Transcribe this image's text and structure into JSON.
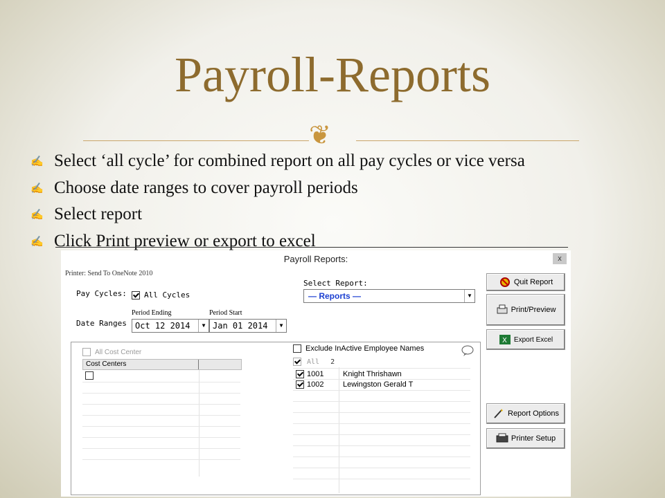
{
  "slide": {
    "title": "Payroll-Reports",
    "ornament": "❦",
    "bullet_icon": "✍",
    "bullets": [
      "Select ‘all cycle’ for combined report on all pay cycles or vice versa",
      "Choose date ranges to cover payroll periods",
      "Select report",
      "Click Print preview or export to excel"
    ]
  },
  "dialog": {
    "title": "Payroll Reports:",
    "close_label": "x",
    "printer_label": "Printer: Send To OneNote 2010",
    "pay_cycles_label": "Pay Cycles:",
    "all_cycles_label": "All Cycles",
    "all_cycles_checked": true,
    "period_ending_label": "Period Ending",
    "period_start_label": "Period Start",
    "date_ranges_label": "Date Ranges",
    "period_ending_value": "Oct 12 2014",
    "period_start_value": "Jan 01 2014",
    "select_report_label": "Select Report:",
    "report_value": "— Reports —",
    "buttons": {
      "quit": "Quit Report",
      "print_preview": "Print/Preview",
      "export_excel": "Export Excel",
      "report_options": "Report Options",
      "printer_setup": "Printer Setup"
    },
    "cost_centers": {
      "all_label": "All Cost Center",
      "header": "Cost Centers"
    },
    "employees": {
      "exclude_label": "Exclude InActive Employee Names",
      "all_label": "All",
      "count": "2",
      "rows": [
        {
          "id": "1001",
          "name": "Knight Thrishawn",
          "checked": true
        },
        {
          "id": "1002",
          "name": "Lewingston Gerald T",
          "checked": true
        }
      ]
    }
  },
  "colors": {
    "title": "#8d6b2e",
    "ornament": "#c9963f",
    "report_text": "#1b3fd1"
  }
}
